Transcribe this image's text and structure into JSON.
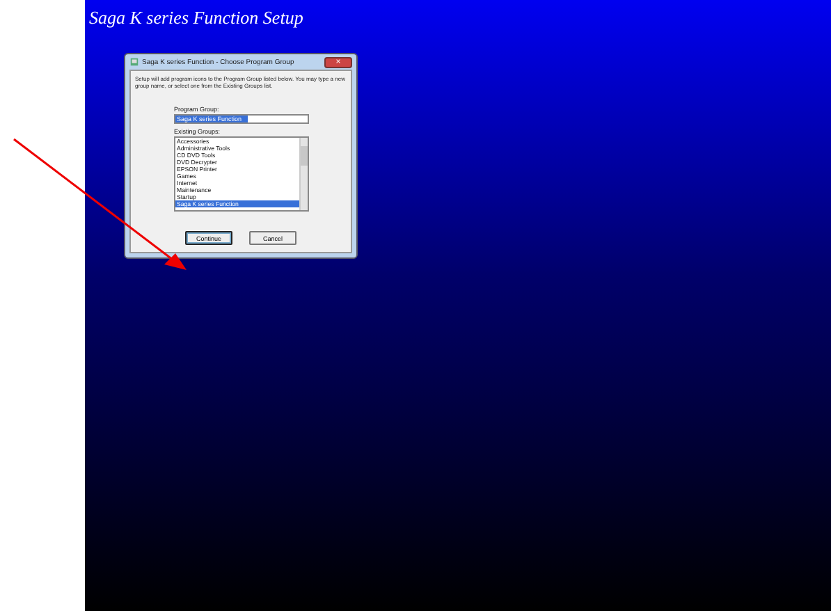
{
  "window": {
    "title": "Saga K series Function Setup"
  },
  "dialog": {
    "title": "Saga K series Function - Choose Program Group",
    "close": "×",
    "instructions": "Setup will add program icons to the Program Group listed below. You may type a new group name, or select one from the Existing Groups list.",
    "program_group": {
      "label": "Program Group:",
      "value": "Saga K series Function"
    },
    "existing_groups": {
      "label": "Existing Groups:",
      "items": [
        {
          "label": "Accessories",
          "selected": false
        },
        {
          "label": "Administrative Tools",
          "selected": false
        },
        {
          "label": "CD DVD Tools",
          "selected": false
        },
        {
          "label": "DVD Decrypter",
          "selected": false
        },
        {
          "label": "EPSON Printer",
          "selected": false
        },
        {
          "label": "Games",
          "selected": false
        },
        {
          "label": "Internet",
          "selected": false
        },
        {
          "label": "Maintenance",
          "selected": false
        },
        {
          "label": "Startup",
          "selected": false
        },
        {
          "label": "Saga K series Function",
          "selected": true
        }
      ]
    },
    "buttons": [
      {
        "label": "Continue",
        "selected": true
      },
      {
        "label": "Cancel",
        "selected": false
      }
    ]
  }
}
